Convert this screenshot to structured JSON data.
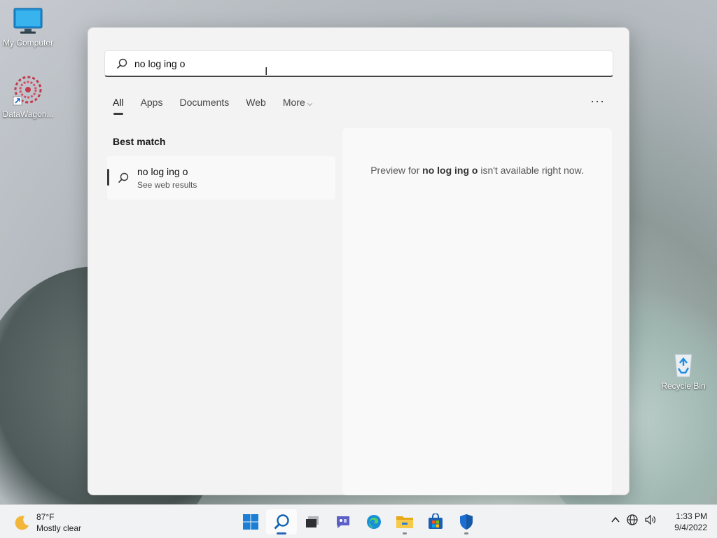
{
  "desktop": {
    "icons": [
      {
        "label": "My Computer"
      },
      {
        "label": "DataWagon..."
      },
      {
        "label": "Recycle Bin"
      }
    ]
  },
  "search": {
    "query": "no log ing o",
    "tabs": [
      "All",
      "Apps",
      "Documents",
      "Web",
      "More"
    ],
    "active_tab": "All",
    "ellipsis": "···",
    "best_match_heading": "Best match",
    "result": {
      "title": "no log ing o",
      "subtitle": "See web results"
    },
    "preview": {
      "prefix": "Preview for ",
      "query": "no log ing o",
      "suffix": " isn't available right now."
    }
  },
  "taskbar": {
    "weather": {
      "temp": "87°F",
      "condition": "Mostly clear"
    },
    "apps": [
      "start-icon",
      "search-icon",
      "task-view-icon",
      "teams-chat-icon",
      "edge-icon",
      "file-explorer-icon",
      "store-icon",
      "security-icon"
    ],
    "clock": {
      "time": "1:33 PM",
      "date": "9/4/2022"
    }
  },
  "colors": {
    "accent": "#2a67b8",
    "panel": "#f3f3f3"
  }
}
